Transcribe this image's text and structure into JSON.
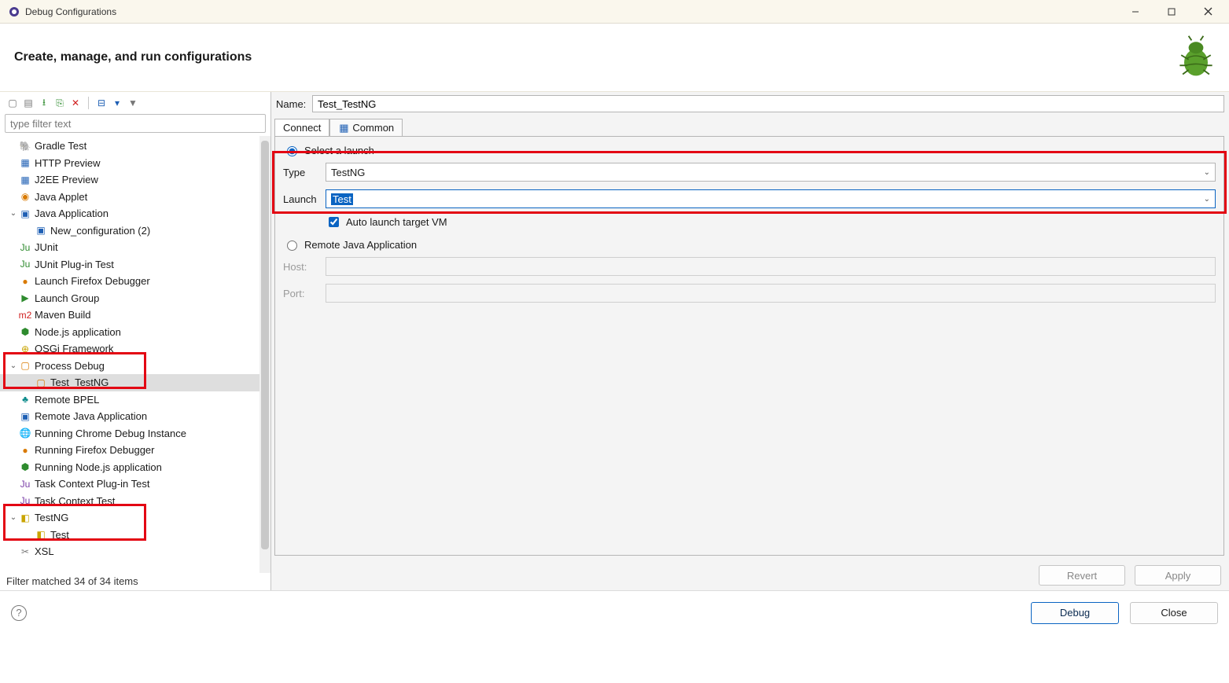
{
  "window": {
    "title": "Debug Configurations"
  },
  "header": {
    "title": "Create, manage, and run configurations"
  },
  "filter": {
    "placeholder": "type filter text"
  },
  "tree": {
    "items": [
      {
        "label": "Gradle Test"
      },
      {
        "label": "HTTP Preview"
      },
      {
        "label": "J2EE Preview"
      },
      {
        "label": "Java Applet"
      },
      {
        "label": "Java Application",
        "expanded": true,
        "children": [
          {
            "label": "New_configuration (2)"
          }
        ]
      },
      {
        "label": "JUnit"
      },
      {
        "label": "JUnit Plug-in Test"
      },
      {
        "label": "Launch Firefox Debugger"
      },
      {
        "label": "Launch Group"
      },
      {
        "label": "Maven Build"
      },
      {
        "label": "Node.js application"
      },
      {
        "label": "OSGi Framework"
      },
      {
        "label": "Process Debug",
        "expanded": true,
        "children": [
          {
            "label": "Test_TestNG",
            "selected": true
          }
        ]
      },
      {
        "label": "Remote BPEL"
      },
      {
        "label": "Remote Java Application"
      },
      {
        "label": "Running Chrome Debug Instance"
      },
      {
        "label": "Running Firefox Debugger"
      },
      {
        "label": "Running Node.js application"
      },
      {
        "label": "Task Context Plug-in Test"
      },
      {
        "label": "Task Context Test"
      },
      {
        "label": "TestNG",
        "expanded": true,
        "children": [
          {
            "label": "Test"
          }
        ]
      },
      {
        "label": "XSL"
      }
    ]
  },
  "status": {
    "text": "Filter matched 34 of 34 items"
  },
  "form": {
    "name_label": "Name:",
    "name_value": "Test_TestNG",
    "tabs": {
      "connect": "Connect",
      "common": "Common"
    },
    "select_launch": "Select a launch",
    "type_label": "Type",
    "type_value": "TestNG",
    "launch_label": "Launch",
    "launch_value": "Test",
    "auto_launch": "Auto launch target VM",
    "remote_java": "Remote Java Application",
    "host_label": "Host:",
    "port_label": "Port:"
  },
  "buttons": {
    "revert": "Revert",
    "apply": "Apply",
    "debug": "Debug",
    "close": "Close"
  }
}
